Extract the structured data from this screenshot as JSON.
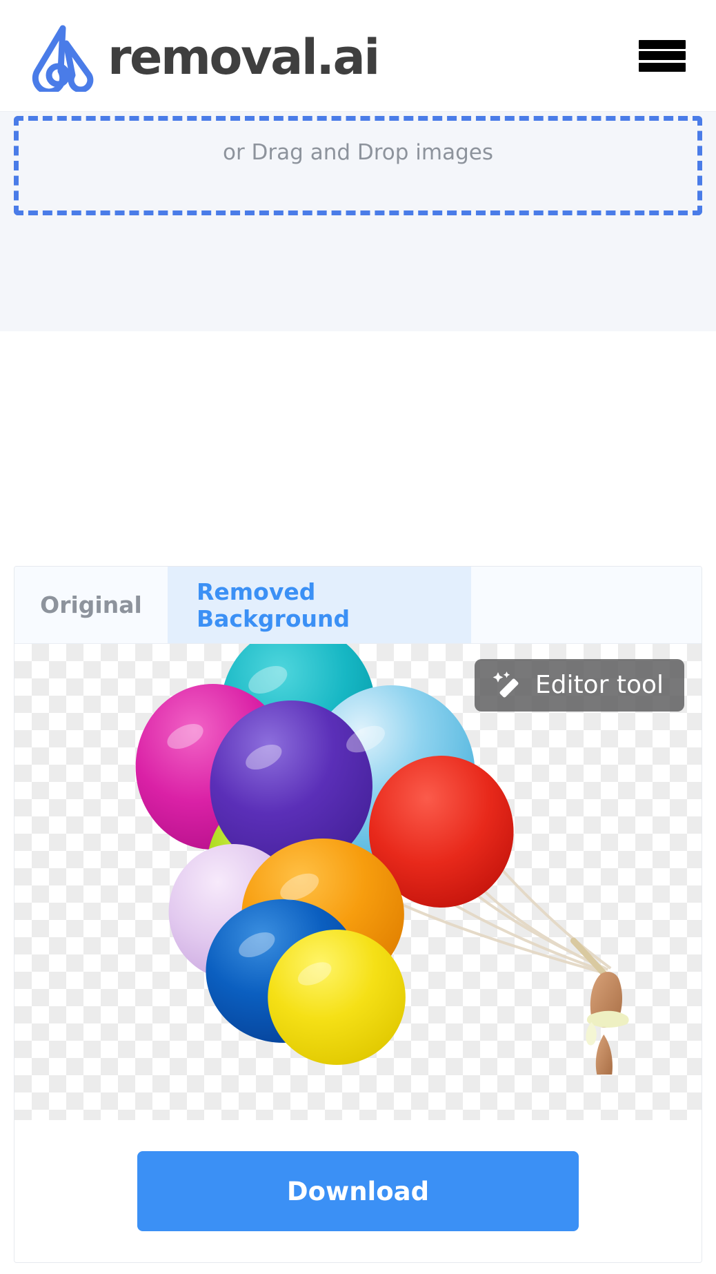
{
  "header": {
    "logo_icon": "removal-ai-logo-icon",
    "brand_text": "removal.ai",
    "menu_icon": "hamburger-menu-icon"
  },
  "dropzone": {
    "text": "or Drag and Drop images",
    "border_color": "#4a7ce8",
    "band_bg": "#f4f6fa"
  },
  "result_card": {
    "tabs": [
      {
        "label": "Original",
        "active": false
      },
      {
        "label": "Removed Background",
        "active": true
      }
    ],
    "editor_button": {
      "label": "Editor tool",
      "icon": "magic-wand-icon"
    },
    "preview": {
      "alt": "balloons-transparent-background",
      "checker_light": "#ffffff",
      "checker_dark": "#ececec"
    },
    "download_button": {
      "label": "Download",
      "color": "#3b90f5"
    }
  },
  "colors": {
    "accent_blue": "#3b90f5",
    "logo_blue": "#4a7ce8",
    "tab_active_bg": "#e3effd",
    "muted_text": "#8d939c"
  }
}
